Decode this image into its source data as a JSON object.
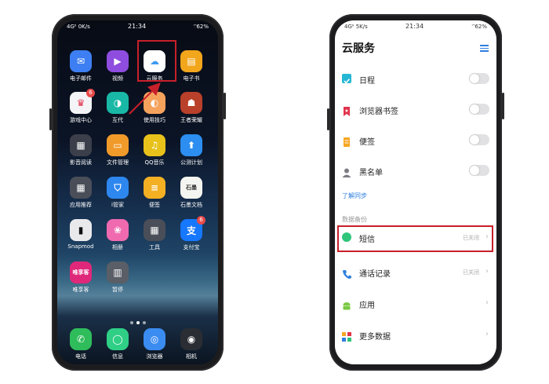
{
  "left_phone": {
    "status": {
      "network": "4Gᴵᴵ 0K/s",
      "time": "21:34",
      "battery": "62%"
    },
    "apps": [
      {
        "label": "电子邮件",
        "color": "#3d7ff2",
        "glyph": "✉",
        "badge": ""
      },
      {
        "label": "视频",
        "color": "#8e4ddf",
        "glyph": "▶",
        "badge": ""
      },
      {
        "label": "云服务",
        "color": "#ffffff",
        "glyph": "☁",
        "badge": ""
      },
      {
        "label": "电子书",
        "color": "#f2a61c",
        "glyph": "▤",
        "badge": ""
      },
      {
        "label": "游戏中心",
        "color": "#f4f4f6",
        "glyph": "♛",
        "badge": "6"
      },
      {
        "label": "互代",
        "color": "#19b8a6",
        "glyph": "◑",
        "badge": ""
      },
      {
        "label": "使用技巧",
        "color": "#f5a25d",
        "glyph": "◐",
        "badge": ""
      },
      {
        "label": "王者荣耀",
        "color": "#b9402a",
        "glyph": "☗",
        "badge": ""
      },
      {
        "label": "影音阅读",
        "color": "#3b3f4a",
        "glyph": "▦",
        "badge": ""
      },
      {
        "label": "文件管理",
        "color": "#f09a2a",
        "glyph": "▭",
        "badge": ""
      },
      {
        "label": "QQ音乐",
        "color": "#e8c21a",
        "glyph": "♫",
        "badge": ""
      },
      {
        "label": "公测计划",
        "color": "#2c8ef0",
        "glyph": "⬆",
        "badge": ""
      },
      {
        "label": "应用推荐",
        "color": "#4a4e58",
        "glyph": "▦",
        "badge": ""
      },
      {
        "label": "i管家",
        "color": "#2e87ee",
        "glyph": "⛉",
        "badge": ""
      },
      {
        "label": "便签",
        "color": "#f3b023",
        "glyph": "≡",
        "badge": ""
      },
      {
        "label": "石墨文档",
        "color": "#f4f4f0",
        "glyph": "石墨",
        "badge": ""
      },
      {
        "label": "Snapmod",
        "color": "#e9e9ec",
        "glyph": "▮",
        "badge": ""
      },
      {
        "label": "相册",
        "color": "#f06ab0",
        "glyph": "❀",
        "badge": ""
      },
      {
        "label": "工具",
        "color": "#4a4e58",
        "glyph": "▦",
        "badge": ""
      },
      {
        "label": "支付宝",
        "color": "#1677ff",
        "glyph": "支",
        "badge": "6"
      },
      {
        "label": "唯享客",
        "color": "#e0287a",
        "glyph": "唯享客",
        "badge": ""
      },
      {
        "label": "暂停",
        "color": "#5a5e66",
        "glyph": "▥",
        "badge": ""
      }
    ],
    "dock": [
      {
        "label": "电话",
        "color": "#2fbd5b",
        "glyph": "✆"
      },
      {
        "label": "信息",
        "color": "#2fcf86",
        "glyph": "◯"
      },
      {
        "label": "浏览器",
        "color": "#3b8cf1",
        "glyph": "◎"
      },
      {
        "label": "相机",
        "color": "#2a2d33",
        "glyph": "◉"
      }
    ]
  },
  "right_phone": {
    "status": {
      "network": "4Gᴵᴵ 5K/s",
      "time": "21:34",
      "battery": "62%"
    },
    "title": "云服务",
    "menu_icon": "menu-lines-icon",
    "sync_items": [
      {
        "label": "日程",
        "icon": "calendar-check-icon",
        "color": "#25b7d3"
      },
      {
        "label": "浏览器书签",
        "icon": "bookmark-star-icon",
        "color": "#e0334c"
      },
      {
        "label": "便签",
        "icon": "notes-icon",
        "color": "#f5a623"
      },
      {
        "label": "黑名单",
        "icon": "person-icon",
        "color": "#7d7d86"
      }
    ],
    "learn_link": "了解同步",
    "backup_section": "数据备份",
    "backup_items": [
      {
        "label": "短信",
        "icon": "sms-circle-icon",
        "color": "#2ec57a",
        "status": "已关闭"
      },
      {
        "label": "通话记录",
        "icon": "phone-icon",
        "color": "#2f7fe0",
        "status": "已关闭"
      },
      {
        "label": "应用",
        "icon": "android-icon",
        "color": "#7ac943",
        "status": ""
      },
      {
        "label": "更多数据",
        "icon": "grid-icon",
        "color": "#f5a623",
        "status": ""
      }
    ],
    "accent_color": "#2f7fe0",
    "highlight_color": "#c8202a"
  }
}
